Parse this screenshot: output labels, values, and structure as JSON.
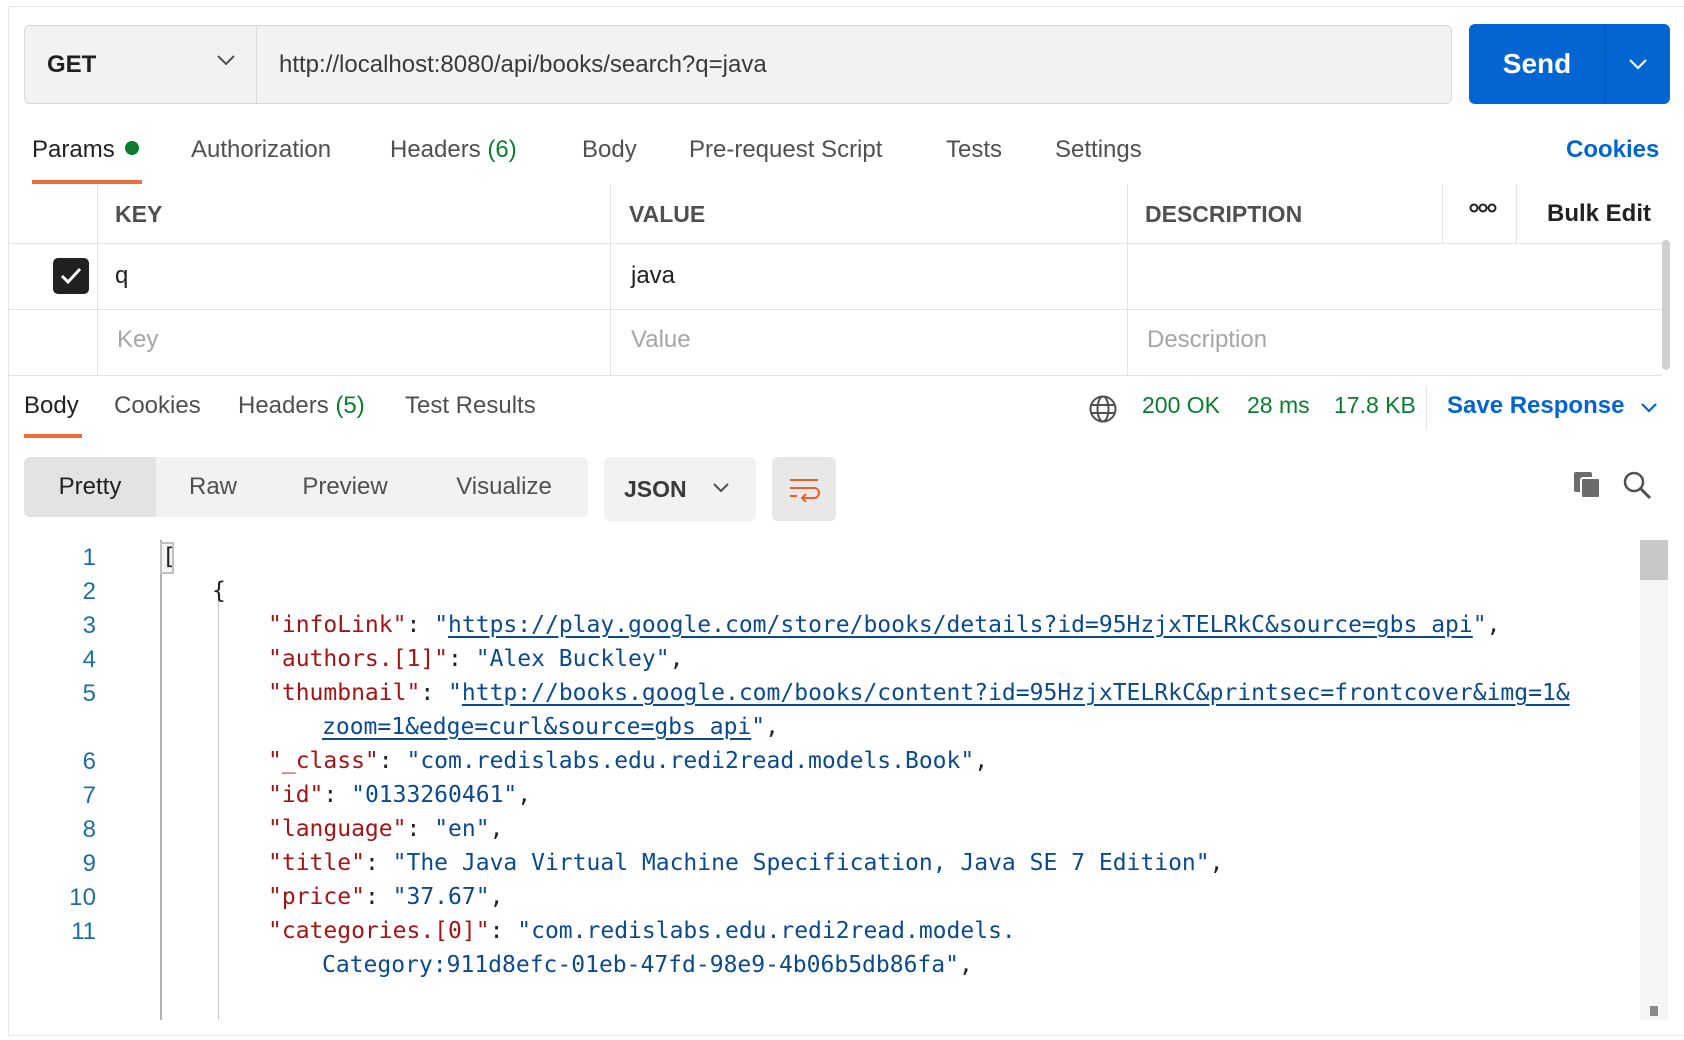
{
  "request": {
    "method": "GET",
    "url": "http://localhost:8080/api/books/search?q=java",
    "send_label": "Send"
  },
  "request_tabs": {
    "params": "Params",
    "authorization": "Authorization",
    "headers": "Headers",
    "headers_count": "(6)",
    "body": "Body",
    "prerequest": "Pre-request Script",
    "tests": "Tests",
    "settings": "Settings",
    "cookies": "Cookies"
  },
  "params_table": {
    "headers": {
      "key": "KEY",
      "value": "VALUE",
      "description": "DESCRIPTION",
      "bulk_edit": "Bulk Edit"
    },
    "rows": [
      {
        "checked": true,
        "key": "q",
        "value": "java",
        "description": ""
      }
    ],
    "placeholders": {
      "key": "Key",
      "value": "Value",
      "description": "Description"
    }
  },
  "response_tabs": {
    "body": "Body",
    "cookies": "Cookies",
    "headers": "Headers",
    "headers_count": "(5)",
    "test_results": "Test Results"
  },
  "response_status": {
    "status": "200 OK",
    "time": "28 ms",
    "size": "17.8 KB",
    "save_response": "Save Response"
  },
  "view_modes": [
    "Pretty",
    "Raw",
    "Preview",
    "Visualize"
  ],
  "format": "JSON",
  "code": {
    "line_numbers": [
      "1",
      "2",
      "3",
      "4",
      "5",
      "6",
      "7",
      "8",
      "9",
      "10",
      "11"
    ],
    "open_bracket": "[",
    "open_brace": "{",
    "fields": {
      "infoLink_key": "\"infoLink\"",
      "infoLink_val": "https://play.google.com/store/books/details?id=95HzjxTELRkC&source=gbs_api",
      "authors_key": "\"authors.[1]\"",
      "authors_val": "\"Alex Buckley\"",
      "thumbnail_key": "\"thumbnail\"",
      "thumbnail_val_1": "http://books.google.com/books/content?id=95HzjxTELRkC&printsec=frontcover&img=1&",
      "thumbnail_val_2": "zoom=1&edge=curl&source=gbs_api",
      "class_key": "\"_class\"",
      "class_val": "\"com.redislabs.edu.redi2read.models.Book\"",
      "id_key": "\"id\"",
      "id_val": "\"0133260461\"",
      "language_key": "\"language\"",
      "language_val": "\"en\"",
      "title_key": "\"title\"",
      "title_val": "\"The Java Virtual Machine Specification, Java SE 7 Edition\"",
      "price_key": "\"price\"",
      "price_val": "\"37.67\"",
      "categories_key": "\"categories.[0]\"",
      "categories_val_1": "\"com.redislabs.edu.redi2read.models.",
      "categories_val_2": "Category:911d8efc-01eb-47fd-98e9-4b06b5db86fa\""
    }
  },
  "colors": {
    "accent_blue": "#0265d2",
    "tab_underline": "#f26b3a",
    "success_green": "#0a7d2e",
    "json_key": "#a31515",
    "json_string": "#0b4a8c"
  }
}
